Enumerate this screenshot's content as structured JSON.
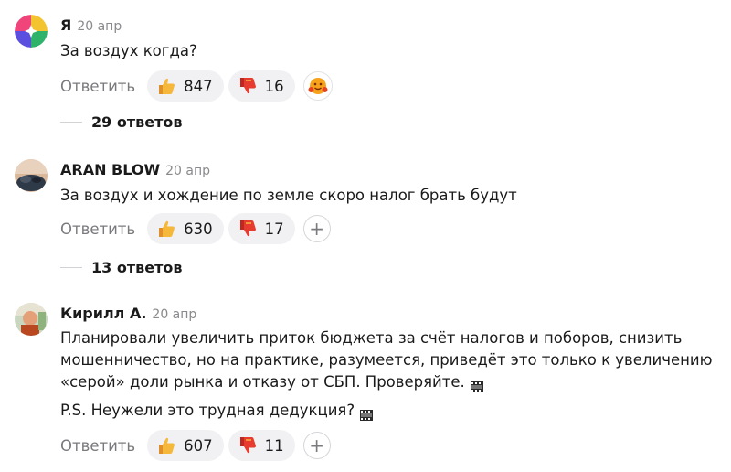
{
  "comments": [
    {
      "author": "Я",
      "date": "20 апр",
      "text": "За воздух когда?",
      "reply_label": "Ответить",
      "likes": "847",
      "dislikes": "16",
      "replies_label": "29 ответов",
      "avatar_icon": "color-wheel-avatar",
      "extra_reaction_icon": "hugging-face-reaction-icon"
    },
    {
      "author": "ARAN BLOW",
      "date": "20 апр",
      "text": "За воздух и хождение по земле скоро налог брать будут",
      "reply_label": "Ответить",
      "likes": "630",
      "dislikes": "17",
      "add_reaction": "+",
      "replies_label": "13 ответов"
    },
    {
      "author": "Кирилл А.",
      "date": "20 апр",
      "paragraphs": [
        "Планировали увеличить приток бюджета за счёт налогов и поборов, снизить мошенничество, но на практике, разумеется, приведёт это только к увеличению «серой» доли рынка и отказу от СБП. Проверяйте.",
        "P.S. Неужели это трудная дедукция?"
      ],
      "reply_label": "Ответить",
      "likes": "607",
      "dislikes": "11",
      "add_reaction": "+"
    }
  ],
  "colors": {
    "pill_bg": "#f1f1f3",
    "muted_text": "#7a7a7e",
    "thumb_yellow": "#f5b83a",
    "thumb_red": "#e63b2e"
  }
}
